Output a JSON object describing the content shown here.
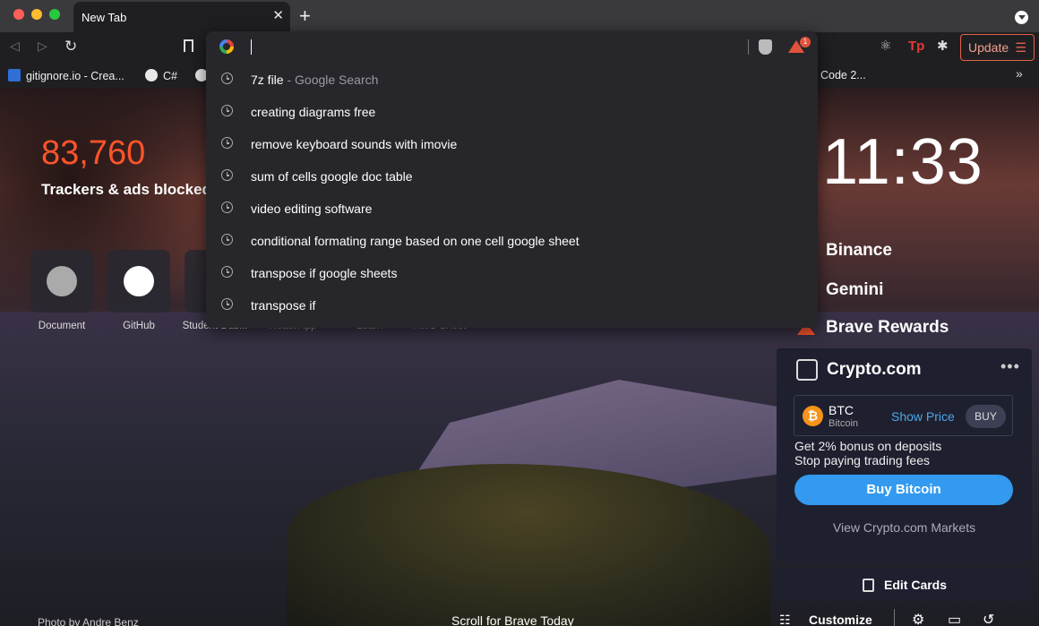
{
  "tab": {
    "title": "New Tab"
  },
  "toolbar": {
    "update_label": "Update"
  },
  "bookmarks": [
    {
      "label": "gitignore.io - Crea...",
      "color": "#2f6fd6"
    },
    {
      "label": "C#",
      "color": "#e8e8e8"
    },
    {
      "label": "Code 2...",
      "color": ""
    }
  ],
  "omnibox": {
    "value": "",
    "suggestions": [
      {
        "text": "7z file",
        "sub": " - Google Search"
      },
      {
        "text": "creating diagrams free",
        "sub": ""
      },
      {
        "text": "remove keyboard sounds with imovie",
        "sub": ""
      },
      {
        "text": "sum of cells google doc table",
        "sub": ""
      },
      {
        "text": "video editing software",
        "sub": ""
      },
      {
        "text": "conditional formating range based on one cell google sheet",
        "sub": ""
      },
      {
        "text": "transpose if google sheets",
        "sub": ""
      },
      {
        "text": "transpose if",
        "sub": ""
      }
    ],
    "rewards_badge": "1"
  },
  "stats": {
    "trackers_count": "83,760",
    "trackers_label": "Trackers & ads blocked"
  },
  "top_sites": [
    {
      "label": "Document"
    },
    {
      "label": "GitHub"
    },
    {
      "label": "Student Das..."
    },
    {
      "label": "React App"
    },
    {
      "label": "Learn"
    },
    {
      "label": "AWS Sheet"
    }
  ],
  "clock": "11:33",
  "cards": {
    "binance": "Binance",
    "gemini": "Gemini",
    "rewards": "Brave Rewards",
    "crypto": {
      "title": "Crypto.com",
      "btc_symbol": "BTC",
      "btc_name": "Bitcoin",
      "show_price": "Show Price",
      "buy": "BUY",
      "promo_line1": "Get 2% bonus on deposits",
      "promo_line2": "Stop paying trading fees",
      "buy_bitcoin": "Buy Bitcoin",
      "markets_link": "View Crypto.com Markets"
    },
    "edit_cards": "Edit Cards"
  },
  "footer": {
    "photo_credit": "Photo by Andre Benz",
    "scroll_today": "Scroll for Brave Today",
    "customize": "Customize"
  },
  "colors": {
    "brave_orange": "#fb542b",
    "crypto_blue": "#339af0",
    "bitcoin": "#f7931a"
  }
}
